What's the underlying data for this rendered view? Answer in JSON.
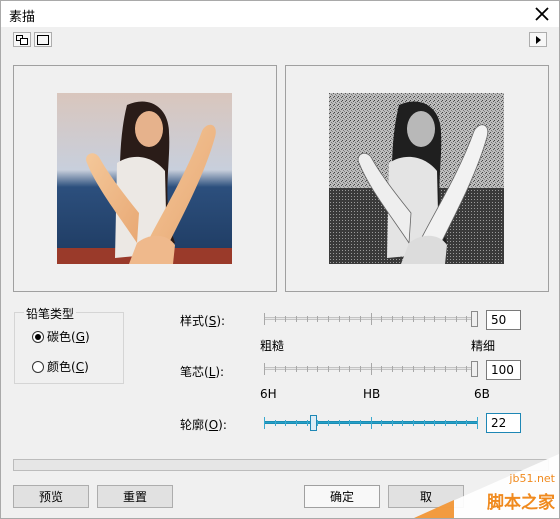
{
  "window": {
    "title": "素描",
    "close_glyph": "✕"
  },
  "toolbar": {
    "left_icons": [
      "dual-preview-icon",
      "single-preview-icon"
    ],
    "right_icon": "expand-arrow-icon"
  },
  "pencil_type": {
    "title": "铅笔类型",
    "options": [
      {
        "label": "碳色(",
        "key": "G",
        "suffix": ")",
        "checked": true
      },
      {
        "label": "颜色(",
        "key": "C",
        "suffix": ")",
        "checked": false
      }
    ]
  },
  "controls": {
    "style": {
      "label": "样式(",
      "key": "S",
      "suffix": "):",
      "value": "50",
      "left_label": "粗糙",
      "right_label": "精细",
      "level": 100
    },
    "lead": {
      "label": "笔芯(",
      "key": "L",
      "suffix": "):",
      "value": "100",
      "labels": [
        "6H",
        "HB",
        "6B"
      ],
      "level": 100
    },
    "outline": {
      "label": "轮廓(",
      "key": "O",
      "suffix": "):",
      "value": "22",
      "level": 22
    }
  },
  "buttons": {
    "preview": "预览",
    "reset": "重置",
    "ok": "确定",
    "cancel": "取"
  },
  "watermark": {
    "site": "jb51.net",
    "brand": "脚本之家"
  },
  "colors": {
    "accent": "#1e87b5",
    "watermark_orange": "#f08a1e"
  }
}
